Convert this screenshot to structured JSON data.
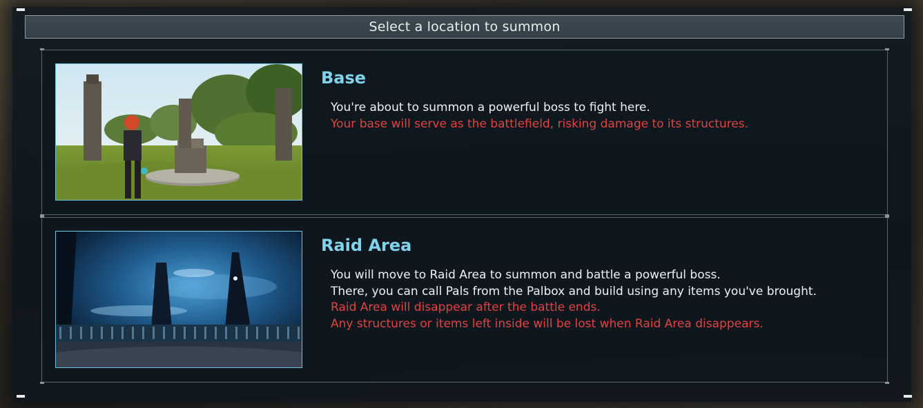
{
  "dialog": {
    "title": "Select a location to summon"
  },
  "options": [
    {
      "title": "Base",
      "image": "base-thumbnail",
      "lines": [
        {
          "text": "You're about to summon a powerful boss to fight here.",
          "tone": "normal"
        },
        {
          "text": "Your base will serve as the battlefield, risking damage to its structures.",
          "tone": "warning"
        }
      ]
    },
    {
      "title": "Raid Area",
      "image": "raid-area-thumbnail",
      "lines": [
        {
          "text": "You will move to Raid Area to summon and battle a powerful boss.",
          "tone": "normal"
        },
        {
          "text": "There, you can call Pals from the Palbox and build using any items you've brought.",
          "tone": "normal"
        },
        {
          "text": "Raid Area will disappear after the battle ends.",
          "tone": "warning"
        },
        {
          "text": "Any structures or items left inside will be lost when Raid Area disappears.",
          "tone": "warning"
        }
      ]
    }
  ],
  "colors": {
    "title_accent": "#7fd4ec",
    "warning_text": "#e2423f",
    "normal_text": "#eef2f4",
    "selection_border": "#66c8e0"
  }
}
